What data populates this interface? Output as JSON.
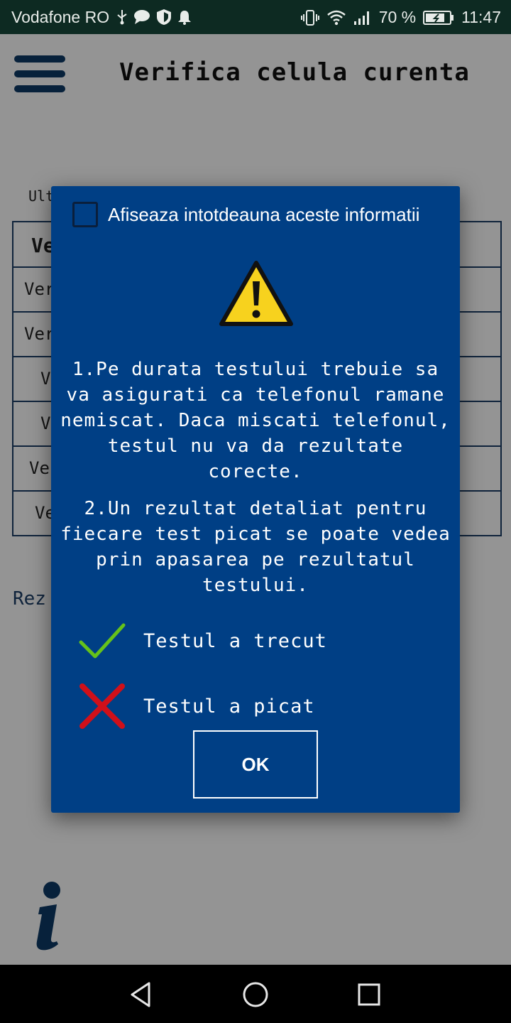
{
  "status_bar": {
    "carrier": "Vodafone RO",
    "battery": "70 %",
    "time": "11:47",
    "icons": [
      "usb-icon",
      "chat-icon",
      "shield-icon",
      "bell-icon",
      "vibrate-icon",
      "wifi-icon",
      "signal-icon",
      "battery-icon"
    ]
  },
  "app": {
    "title": "Verifica celula curenta",
    "last_label": "Ult",
    "table_rows": [
      "Ve",
      "Ver",
      "Ver",
      "V",
      "V",
      "Ve",
      "Ve"
    ],
    "results_label": "Rez"
  },
  "dialog": {
    "checkbox_label": "Afiseaza intotdeauna aceste informatii",
    "checkbox_checked": false,
    "message1": "1.Pe durata testului trebuie sa va asigurati ca telefonul ramane nemiscat. Daca miscati telefonul, testul nu va da rezultate corecte.",
    "message2": "2.Un rezultat detaliat pentru fiecare test picat se poate vedea prin apasarea pe rezultatul testului.",
    "legend_pass": "Testul a trecut",
    "legend_fail": "Testul a picat",
    "ok_label": "OK"
  },
  "colors": {
    "dialog_bg": "#003f85",
    "pass": "#66c21a",
    "fail": "#d0101a",
    "warning": "#f7d21e"
  }
}
